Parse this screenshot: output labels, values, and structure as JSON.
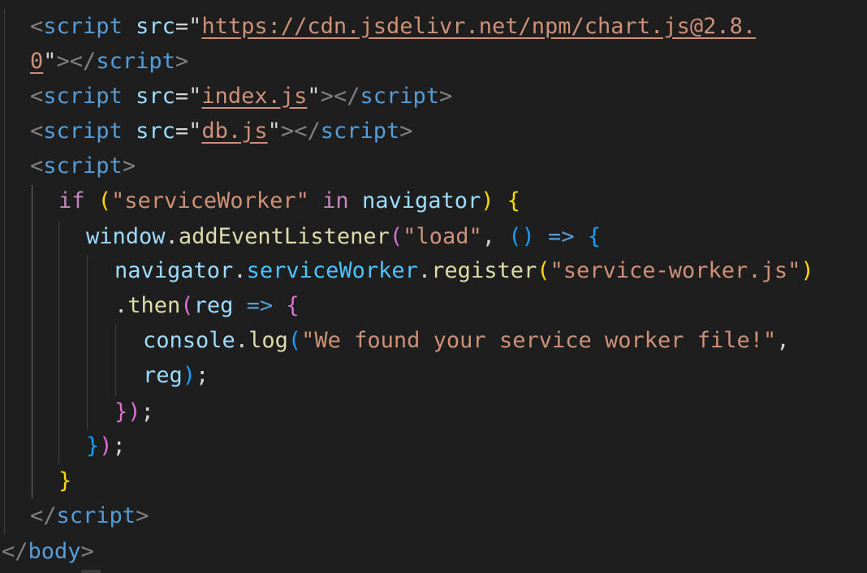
{
  "editor": {
    "theme_colors": {
      "background": "#1e1e1e",
      "tag": "#569cd6",
      "attribute": "#9cdcfe",
      "string": "#ce9178",
      "keyword": "#c586c0",
      "function": "#dcdcaa",
      "bracket_gold": "#ffd700",
      "bracket_orchid": "#da70d6",
      "bracket_blue": "#179fff"
    },
    "tokens": {
      "lt": "<",
      "gt": ">",
      "lt_slash": "</",
      "script": "script",
      "body": "body",
      "src": "src",
      "eq_quote": "=\"",
      "quote": "\"",
      "quote_gt": "\">",
      "url_part1": "https://cdn.jsdelivr.net/npm/chart.js@2.8.",
      "url_part2": "0",
      "index_js": "index.js",
      "db_js": "db.js",
      "if": "if",
      "paren_open": "(",
      "paren_close": ")",
      "service_worker_str": "\"serviceWorker\"",
      "in": "in",
      "navigator": "navigator",
      "brace_open": "{",
      "brace_close": "}",
      "window": "window",
      "dot": ".",
      "addEventListener": "addEventListener",
      "load_str": "\"load\"",
      "comma": ",",
      "arrow": "=>",
      "serviceWorker_prop": "serviceWorker",
      "register": "register",
      "sw_file_str": "\"service-worker.js\"",
      "then": "then",
      "reg": "reg",
      "console": "console",
      "log": "log",
      "log_msg_str": "\"We found your service worker file!\"",
      "semicolon": ";",
      "space": " "
    }
  }
}
